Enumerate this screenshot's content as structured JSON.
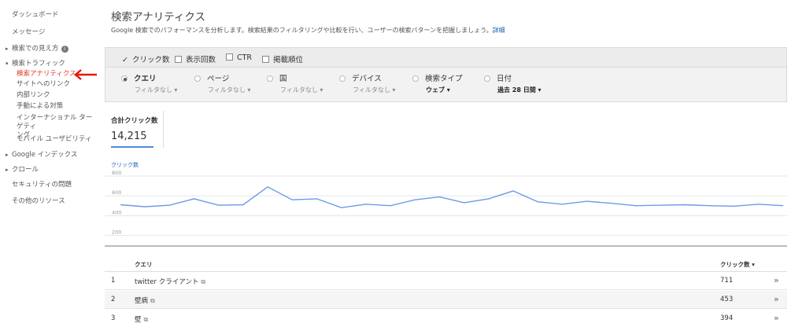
{
  "sidebar": {
    "dashboard": "ダッシュボード",
    "messages": "メッセージ",
    "search_appearance": "検索での見え方",
    "search_traffic": "検索トラフィック",
    "sub_items": [
      "検索アナリティクス",
      "サイトへのリンク",
      "内部リンク",
      "手動による対策",
      "インターナショナル ターゲティ",
      "ング",
      "モバイル ユーザビリティ"
    ],
    "google_index": "Google インデックス",
    "crawl": "クロール",
    "security": "セキュリティの問題",
    "other_resources": "その他のリソース",
    "accent_color": "#dd3b26"
  },
  "header": {
    "title": "検索アナリティクス",
    "description": "Google 検索でのパフォーマンスを分析します。検索結果のフィルタリングや比較を行い、ユーザーの検索パターンを把握しましょう。",
    "details_link": "詳細"
  },
  "metrics": {
    "clicks": "クリック数",
    "impressions": "表示回数",
    "ctr": "CTR",
    "position": "掲載順位"
  },
  "dimensions": {
    "query": {
      "label": "クエリ",
      "sub": "フィルタなし ▾"
    },
    "page": {
      "label": "ページ",
      "sub": "フィルタなし ▾"
    },
    "country": {
      "label": "国",
      "sub": "フィルタなし ▾"
    },
    "device": {
      "label": "デバイス",
      "sub": "フィルタなし ▾"
    },
    "search_type": {
      "label": "検索タイプ",
      "sub": "ウェブ ▾"
    },
    "date": {
      "label": "日付",
      "sub": "過去 28 日間 ▾"
    }
  },
  "totals": {
    "label": "合計クリック数",
    "value": "14,215"
  },
  "chart": {
    "title": "クリック数"
  },
  "chart_data": {
    "type": "line",
    "title": "クリック数",
    "ylim": [
      100,
      800
    ],
    "yticks": [
      "800",
      "600",
      "400",
      "200"
    ],
    "series": [
      {
        "name": "クリック数",
        "values": [
          510,
          490,
          505,
          570,
          505,
          510,
          690,
          560,
          570,
          480,
          515,
          500,
          560,
          590,
          530,
          570,
          650,
          540,
          515,
          545,
          525,
          500,
          505,
          510,
          500,
          495,
          515,
          500
        ]
      }
    ],
    "color": "#6b9be8",
    "grid": true
  },
  "table": {
    "col_query": "クエリ",
    "col_clicks": "クリック数 ▾",
    "rows": [
      {
        "num": "1",
        "query": "twitter クライアント",
        "clicks": "711"
      },
      {
        "num": "2",
        "query": "壁病",
        "clicks": "453"
      },
      {
        "num": "3",
        "query": "壁",
        "clicks": "394"
      }
    ]
  }
}
